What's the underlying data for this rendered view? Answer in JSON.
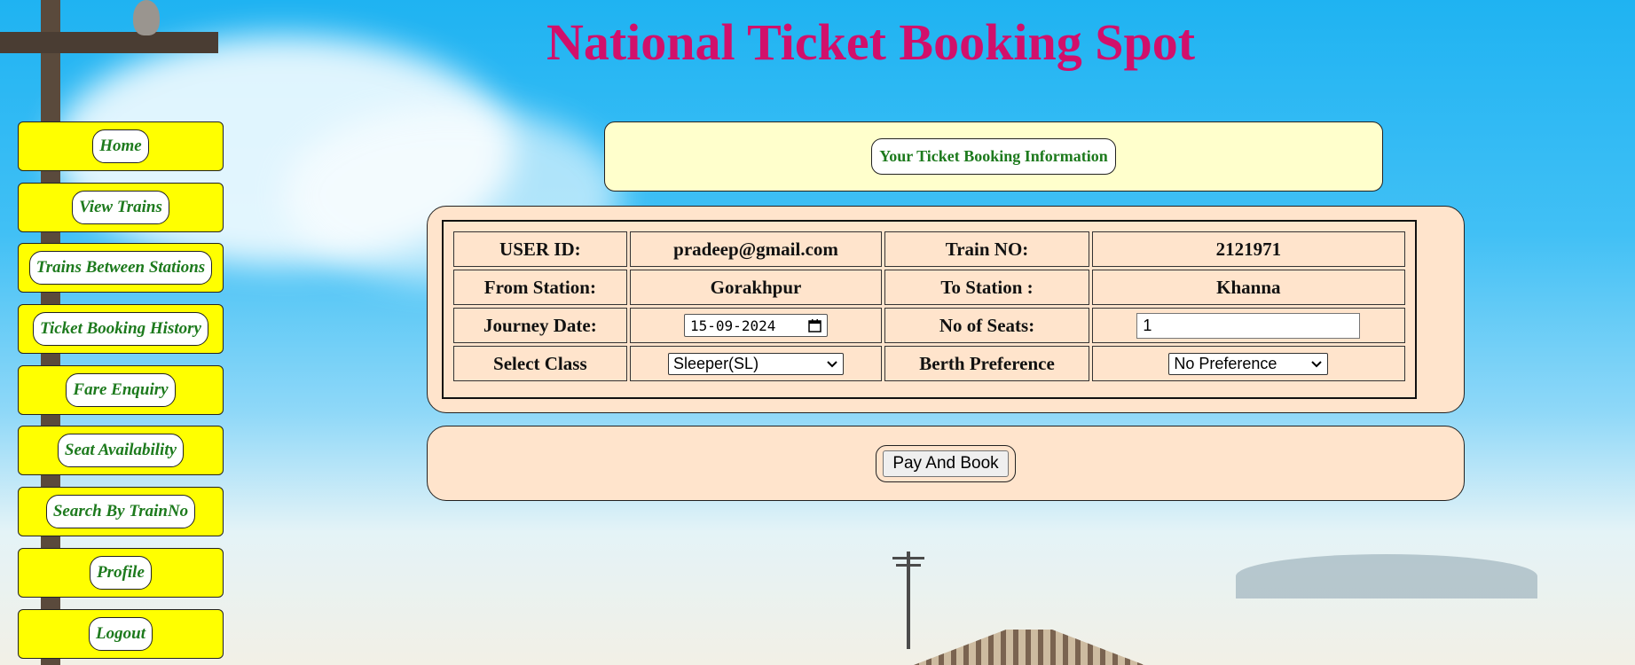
{
  "page": {
    "title": "National Ticket Booking Spot"
  },
  "sidebar": {
    "items": [
      {
        "label": "Home"
      },
      {
        "label": "View Trains"
      },
      {
        "label": "Trains Between Stations"
      },
      {
        "label": "Ticket Booking History"
      },
      {
        "label": "Fare Enquiry"
      },
      {
        "label": "Seat Availability"
      },
      {
        "label": "Search By TrainNo"
      },
      {
        "label": "Profile"
      },
      {
        "label": "Logout"
      }
    ]
  },
  "info_header": {
    "label": "Your Ticket Booking Information"
  },
  "booking": {
    "user_id_label": "USER ID:",
    "user_id_value": "pradeep@gmail.com",
    "train_no_label": "Train NO:",
    "train_no_value": "2121971",
    "from_label": "From Station:",
    "from_value": "Gorakhpur",
    "to_label": "To Station :",
    "to_value": "Khanna",
    "journey_date_label": "Journey Date:",
    "journey_date_value": "15-09-2024",
    "seats_label": "No of Seats:",
    "seats_value": "1",
    "class_label": "Select Class",
    "class_value": "Sleeper(SL)",
    "berth_label": "Berth Preference",
    "berth_value": "No Preference"
  },
  "actions": {
    "pay_label": "Pay And Book"
  },
  "icons": {
    "calendar": "calendar-icon",
    "dropdown": "chevron-down-icon"
  },
  "colors": {
    "title": "#d1106b",
    "nav_background": "#ffff00",
    "nav_text": "#1d7a1d",
    "panel_background": "#ffe4cc",
    "info_background": "#ffffcc"
  }
}
